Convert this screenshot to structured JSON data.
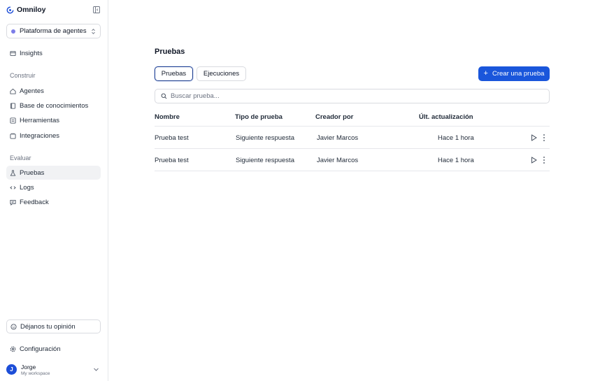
{
  "sidebar": {
    "brand": "Omniloy",
    "workspace": "Plataforma de agentes",
    "insights": "Insights",
    "build_section": "Construir",
    "build_items": [
      "Agentes",
      "Base de conocimientos",
      "Herramientas",
      "Integraciones"
    ],
    "evaluate_section": "Evaluar",
    "evaluate_items": [
      "Pruebas",
      "Logs",
      "Feedback"
    ],
    "feedback_button": "Déjanos tu opinión",
    "settings": "Configuración",
    "user": {
      "initial": "J",
      "name": "Jorge",
      "workspace": "My workspace"
    }
  },
  "main": {
    "title": "Pruebas",
    "tabs": [
      "Pruebas",
      "Ejecuciones"
    ],
    "active_tab": "Pruebas",
    "create_button": "Crear una prueba",
    "search_placeholder": "Buscar prueba...",
    "table": {
      "headers": [
        "Nombre",
        "Tipo de prueba",
        "Creador por",
        "Últ. actualización"
      ],
      "rows": [
        [
          "Prueba test",
          "Siguiente respuesta",
          "Javier Marcos",
          "Hace 1 hora"
        ],
        [
          "Prueba test",
          "Siguiente respuesta",
          "Javier Marcos",
          "Hace 1 hora"
        ]
      ]
    }
  },
  "colors": {
    "accent": "#1a56db",
    "brand_icon": "#1d4ed8",
    "workspace_dot": "#7c7de8"
  },
  "icons": [
    "omniloy-logo-icon",
    "sidebar-collapse-icon",
    "chevron-updown-icon",
    "insights-icon",
    "agents-icon",
    "knowledge-base-icon",
    "tools-icon",
    "integrations-icon",
    "tests-icon",
    "logs-icon",
    "feedback-icon",
    "smile-icon",
    "settings-icon",
    "chevron-down-icon",
    "plus-icon",
    "search-icon",
    "play-icon",
    "more-vertical-icon"
  ]
}
